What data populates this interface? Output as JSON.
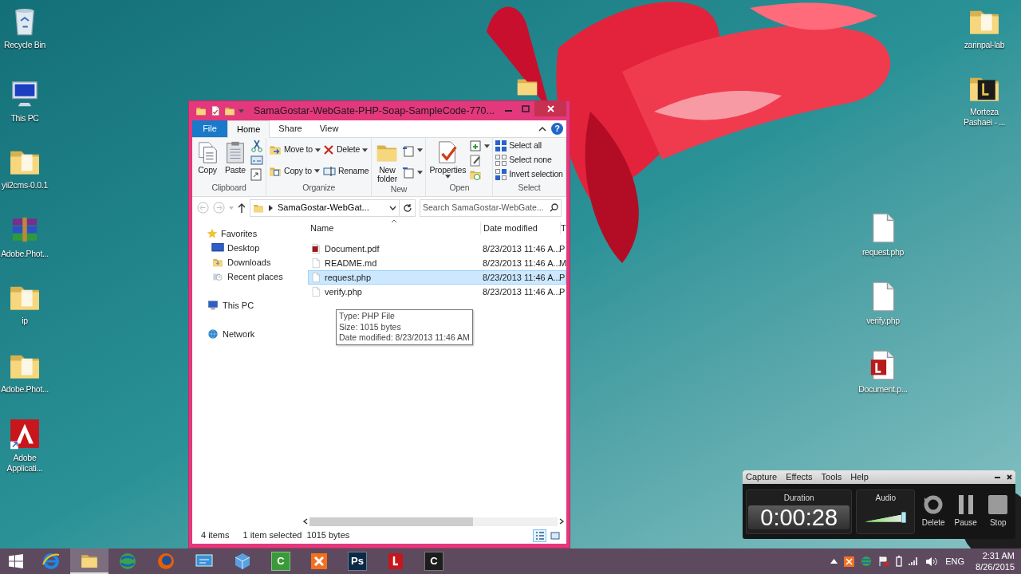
{
  "desktop_left": [
    {
      "label": "Recycle Bin",
      "kind": "bin"
    },
    {
      "label": "This PC",
      "kind": "pc"
    },
    {
      "label": "yii2cms-0.0.1",
      "kind": "folder"
    },
    {
      "label": "Adobe.Phot...",
      "kind": "archive"
    },
    {
      "label": "ip",
      "kind": "folder"
    },
    {
      "label": "Adobe.Phot...",
      "kind": "folder"
    },
    {
      "label": "Adobe Applicati...",
      "kind": "adobe"
    }
  ],
  "desktop_right": [
    {
      "label": "zarinpal-lab",
      "kind": "folder"
    },
    {
      "label": "Morteza Pashaei - ...",
      "kind": "darkfolder"
    },
    {
      "label": "request.php",
      "kind": "file"
    },
    {
      "label": "verify.php",
      "kind": "file"
    },
    {
      "label": "Document.p...",
      "kind": "pdf"
    }
  ],
  "explorer": {
    "title": "SamaGostar-WebGate-PHP-Soap-SampleCode-770...",
    "tabs": [
      {
        "label": "File",
        "kind": "file",
        "selected": false
      },
      {
        "label": "Home",
        "kind": "tab",
        "selected": true
      },
      {
        "label": "Share",
        "kind": "tab",
        "selected": false
      },
      {
        "label": "View",
        "kind": "tab",
        "selected": false
      }
    ],
    "help": "?",
    "groups": [
      {
        "label": "Clipboard",
        "columns": [
          [
            {
              "label": "Copy",
              "kind": "large",
              "dropdown": false
            }
          ],
          [
            {
              "label": "Paste",
              "kind": "large",
              "dropdown": false
            }
          ],
          [
            {
              "kind": "small",
              "dropdown": false
            },
            {
              "kind": "small",
              "dropdown": false
            },
            {
              "kind": "small",
              "dropdown": false
            }
          ]
        ]
      },
      {
        "label": "Organize",
        "columns": [
          [
            {
              "label": "Move to",
              "kind": "small",
              "dropdown": true
            },
            {
              "label": "Copy to",
              "kind": "small",
              "dropdown": true
            }
          ],
          [
            {
              "label": "Delete",
              "kind": "small",
              "dropdown": true
            },
            {
              "label": "Rename",
              "kind": "small",
              "dropdown": false
            }
          ]
        ]
      },
      {
        "label": "New",
        "columns": [
          [
            {
              "label": "New folder",
              "kind": "large",
              "dropdown": false
            }
          ],
          [
            {
              "kind": "small",
              "dropdown": true
            },
            {
              "kind": "small",
              "dropdown": true
            }
          ]
        ]
      },
      {
        "label": "Open",
        "columns": [
          [
            {
              "label": "Properties",
              "kind": "large",
              "dropdown": true
            }
          ],
          [
            {
              "kind": "small",
              "dropdown": true
            },
            {
              "kind": "small",
              "dropdown": false
            },
            {
              "kind": "small",
              "dropdown": false
            }
          ]
        ]
      },
      {
        "label": "Select",
        "columns": [
          [
            {
              "label": "Select all",
              "kind": "small",
              "dropdown": false
            },
            {
              "label": "Select none",
              "kind": "small",
              "dropdown": false
            },
            {
              "label": "Invert selection",
              "kind": "small",
              "dropdown": false
            }
          ]
        ]
      }
    ],
    "address": "SamaGostar-WebGat...",
    "search": {
      "placeholder": "Search SamaGostar-WebGate..."
    },
    "nav": [
      {
        "label": "Favorites",
        "kind": "star",
        "children": [
          {
            "label": "Desktop",
            "kind": "desktop"
          },
          {
            "label": "Downloads",
            "kind": "downloads"
          },
          {
            "label": "Recent places",
            "kind": "recent"
          }
        ]
      },
      {
        "label": "This PC",
        "kind": "pc"
      },
      {
        "label": "Network",
        "kind": "network"
      }
    ],
    "columns": [
      "Name",
      "Date modified",
      "T"
    ],
    "files": [
      {
        "name": "Document.pdf",
        "kind": "pdf",
        "date": "8/23/2013 11:46 A...",
        "type": "P",
        "selected": false
      },
      {
        "name": "README.md",
        "kind": "file",
        "date": "8/23/2013 11:46 A...",
        "type": "M",
        "selected": false
      },
      {
        "name": "request.php",
        "kind": "file",
        "date": "8/23/2013 11:46 A...",
        "type": "P",
        "selected": true
      },
      {
        "name": "verify.php",
        "kind": "file",
        "date": "8/23/2013 11:46 A...",
        "type": "P",
        "selected": false
      }
    ],
    "tooltip": [
      "Type: PHP File",
      "Size: 1015 bytes",
      "Date modified: 8/23/2013 11:46 AM"
    ],
    "status": {
      "count": "4 items",
      "selection": "1 item selected",
      "size": "1015 bytes"
    },
    "views": [
      {
        "selected": true
      },
      {
        "selected": false
      }
    ]
  },
  "recorder": {
    "menu": [
      "Capture",
      "Effects",
      "Tools",
      "Help"
    ],
    "duration_label": "Duration",
    "duration": "0:00:28",
    "audio_label": "Audio",
    "audio": {
      "level": 0.93
    },
    "buttons": [
      {
        "label": "Delete",
        "kind": "delete"
      },
      {
        "label": "Pause",
        "kind": "pause"
      },
      {
        "label": "Stop",
        "kind": "stop"
      }
    ]
  },
  "taskbar": {
    "apps": [
      {
        "kind": "browser",
        "active": false
      },
      {
        "kind": "folder",
        "active": true
      },
      {
        "kind": "globe",
        "active": false
      },
      {
        "kind": "firefox",
        "active": false
      },
      {
        "kind": "panel",
        "active": false
      },
      {
        "kind": "cube",
        "active": false
      },
      {
        "kind": "letter",
        "label": "C",
        "color": "#3a9a3a",
        "active": false
      },
      {
        "kind": "xampp",
        "active": false
      },
      {
        "kind": "letter",
        "label": "Ps",
        "color": "#0b2a45",
        "active": false
      },
      {
        "kind": "redapp",
        "active": false
      },
      {
        "kind": "letter",
        "label": "C",
        "color": "#1d1d1d",
        "active": false
      }
    ],
    "language": "ENG",
    "time": "2:31 AM",
    "date": "8/26/2015"
  }
}
